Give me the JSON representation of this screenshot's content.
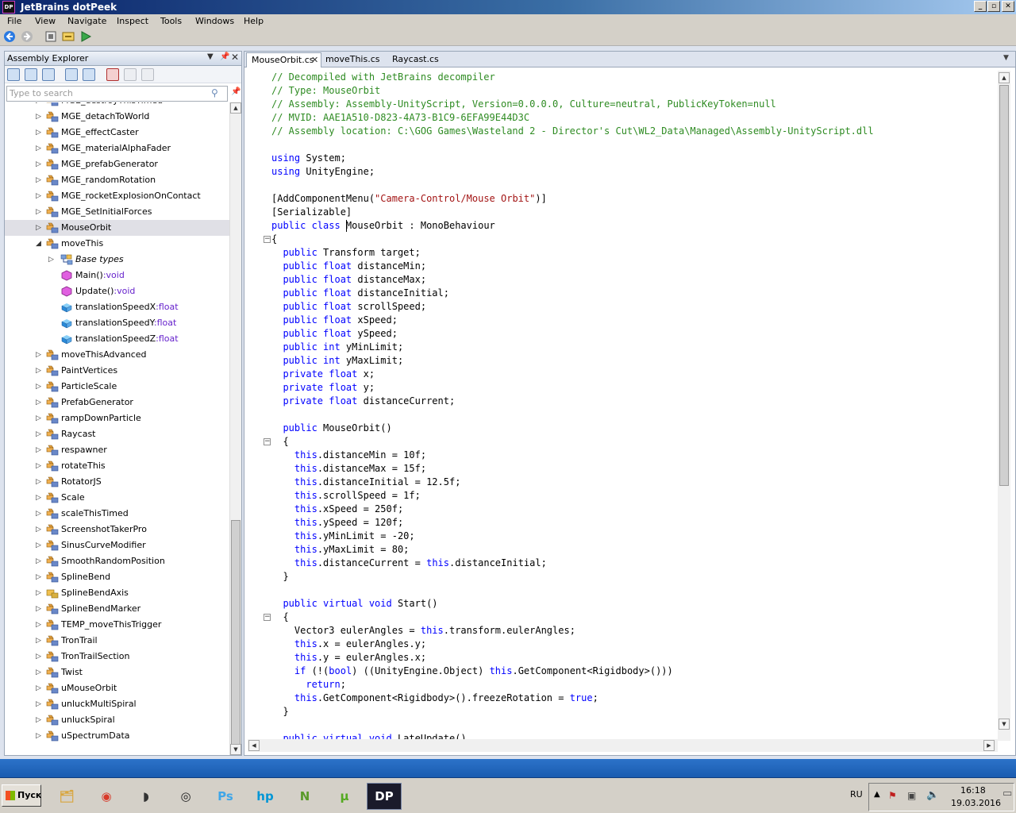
{
  "window": {
    "title": "JetBrains dotPeek",
    "icon": "DP",
    "minimize": "_",
    "maximize": "▫",
    "close": "✕"
  },
  "menu": [
    "File",
    "View",
    "Navigate",
    "Inspect",
    "Tools",
    "Windows",
    "Help"
  ],
  "explorer": {
    "title": "Assembly Explorer",
    "search_placeholder": "Type to search",
    "items": [
      {
        "label": "MGE_destroyThisTimed",
        "icon": "class-icon",
        "level": 0,
        "arrow": "▷"
      },
      {
        "label": "MGE_detachToWorld",
        "icon": "class-icon",
        "level": 0,
        "arrow": "▷"
      },
      {
        "label": "MGE_effectCaster",
        "icon": "class-icon",
        "level": 0,
        "arrow": "▷"
      },
      {
        "label": "MGE_materialAlphaFader",
        "icon": "class-icon",
        "level": 0,
        "arrow": "▷"
      },
      {
        "label": "MGE_prefabGenerator",
        "icon": "class-icon",
        "level": 0,
        "arrow": "▷"
      },
      {
        "label": "MGE_randomRotation",
        "icon": "class-icon",
        "level": 0,
        "arrow": "▷"
      },
      {
        "label": "MGE_rocketExplosionOnContact",
        "icon": "class-icon",
        "level": 0,
        "arrow": "▷"
      },
      {
        "label": "MGE_SetInitialForces",
        "icon": "class-icon",
        "level": 0,
        "arrow": "▷"
      },
      {
        "label": "MouseOrbit",
        "icon": "class-icon",
        "level": 0,
        "arrow": "▷",
        "selected": true
      },
      {
        "label": "moveThis",
        "icon": "class-icon",
        "level": 0,
        "arrow": "◢"
      },
      {
        "label": "Base types",
        "icon": "base-types-icon",
        "level": 1,
        "arrow": "▷",
        "italic": true
      },
      {
        "label": "Main()",
        "type": ":void",
        "icon": "method-icon",
        "level": 1,
        "arrow": ""
      },
      {
        "label": "Update()",
        "type": ":void",
        "icon": "method-icon",
        "level": 1,
        "arrow": ""
      },
      {
        "label": "translationSpeedX",
        "type": ":float",
        "icon": "field-icon",
        "level": 1,
        "arrow": ""
      },
      {
        "label": "translationSpeedY",
        "type": ":float",
        "icon": "field-icon",
        "level": 1,
        "arrow": ""
      },
      {
        "label": "translationSpeedZ",
        "type": ":float",
        "icon": "field-icon",
        "level": 1,
        "arrow": ""
      },
      {
        "label": "moveThisAdvanced",
        "icon": "class-icon",
        "level": 0,
        "arrow": "▷"
      },
      {
        "label": "PaintVertices",
        "icon": "class-icon",
        "level": 0,
        "arrow": "▷"
      },
      {
        "label": "ParticleScale",
        "icon": "class-icon",
        "level": 0,
        "arrow": "▷"
      },
      {
        "label": "PrefabGenerator",
        "icon": "class-icon",
        "level": 0,
        "arrow": "▷"
      },
      {
        "label": "rampDownParticle",
        "icon": "class-icon",
        "level": 0,
        "arrow": "▷"
      },
      {
        "label": "Raycast",
        "icon": "class-icon",
        "level": 0,
        "arrow": "▷"
      },
      {
        "label": "respawner",
        "icon": "class-icon",
        "level": 0,
        "arrow": "▷"
      },
      {
        "label": "rotateThis",
        "icon": "class-icon",
        "level": 0,
        "arrow": "▷"
      },
      {
        "label": "RotatorJS",
        "icon": "class-icon",
        "level": 0,
        "arrow": "▷"
      },
      {
        "label": "Scale",
        "icon": "class-icon",
        "level": 0,
        "arrow": "▷"
      },
      {
        "label": "scaleThisTimed",
        "icon": "class-icon",
        "level": 0,
        "arrow": "▷"
      },
      {
        "label": "ScreenshotTakerPro",
        "icon": "class-icon",
        "level": 0,
        "arrow": "▷"
      },
      {
        "label": "SinusCurveModifier",
        "icon": "class-icon",
        "level": 0,
        "arrow": "▷"
      },
      {
        "label": "SmoothRandomPosition",
        "icon": "class-icon",
        "level": 0,
        "arrow": "▷"
      },
      {
        "label": "SplineBend",
        "icon": "class-icon",
        "level": 0,
        "arrow": "▷"
      },
      {
        "label": "SplineBendAxis",
        "icon": "enum-icon",
        "level": 0,
        "arrow": "▷"
      },
      {
        "label": "SplineBendMarker",
        "icon": "class-icon",
        "level": 0,
        "arrow": "▷"
      },
      {
        "label": "TEMP_moveThisTrigger",
        "icon": "class-icon",
        "level": 0,
        "arrow": "▷"
      },
      {
        "label": "TronTrail",
        "icon": "class-icon",
        "level": 0,
        "arrow": "▷"
      },
      {
        "label": "TronTrailSection",
        "icon": "class-icon",
        "level": 0,
        "arrow": "▷"
      },
      {
        "label": "Twist",
        "icon": "class-icon",
        "level": 0,
        "arrow": "▷"
      },
      {
        "label": "uMouseOrbit",
        "icon": "class-icon",
        "level": 0,
        "arrow": "▷"
      },
      {
        "label": "unluckMultiSpiral",
        "icon": "class-icon",
        "level": 0,
        "arrow": "▷"
      },
      {
        "label": "unluckSpiral",
        "icon": "class-icon",
        "level": 0,
        "arrow": "▷"
      },
      {
        "label": "uSpectrumData",
        "icon": "class-icon",
        "level": 0,
        "arrow": "▷"
      }
    ]
  },
  "tabs": [
    {
      "label": "MouseOrbit.cs",
      "active": true
    },
    {
      "label": "moveThis.cs",
      "active": false
    },
    {
      "label": "Raycast.cs",
      "active": false
    }
  ],
  "code": [
    [
      [
        "cm",
        "// Decompiled with JetBrains decompiler"
      ]
    ],
    [
      [
        "cm",
        "// Type: MouseOrbit"
      ]
    ],
    [
      [
        "cm",
        "// Assembly: Assembly-UnityScript, Version=0.0.0.0, Culture=neutral, PublicKeyToken=null"
      ]
    ],
    [
      [
        "cm",
        "// MVID: AAE1A510-D823-4A73-B1C9-6EFA99E44D3C"
      ]
    ],
    [
      [
        "cm",
        "// Assembly location: C:\\GOG Games\\Wasteland 2 - Director's Cut\\WL2_Data\\Managed\\Assembly-UnityScript.dll"
      ]
    ],
    [],
    [
      [
        "kw",
        "using"
      ],
      [
        "",
        " System;"
      ]
    ],
    [
      [
        "kw",
        "using"
      ],
      [
        "",
        " UnityEngine;"
      ]
    ],
    [],
    [
      [
        "",
        "[AddComponentMenu("
      ],
      [
        "st",
        "\"Camera-Control/Mouse Orbit\""
      ],
      [
        "",
        ")]"
      ]
    ],
    [
      [
        "",
        "[Serializable]"
      ]
    ],
    [
      [
        "kw",
        "public class"
      ],
      [
        "",
        " MouseOrbit : MonoBehaviour"
      ]
    ],
    [
      [
        "",
        "{"
      ]
    ],
    [
      [
        "",
        "  "
      ],
      [
        "kw",
        "public"
      ],
      [
        "",
        " Transform target;"
      ]
    ],
    [
      [
        "",
        "  "
      ],
      [
        "kw",
        "public float"
      ],
      [
        "",
        " distanceMin;"
      ]
    ],
    [
      [
        "",
        "  "
      ],
      [
        "kw",
        "public float"
      ],
      [
        "",
        " distanceMax;"
      ]
    ],
    [
      [
        "",
        "  "
      ],
      [
        "kw",
        "public float"
      ],
      [
        "",
        " distanceInitial;"
      ]
    ],
    [
      [
        "",
        "  "
      ],
      [
        "kw",
        "public float"
      ],
      [
        "",
        " scrollSpeed;"
      ]
    ],
    [
      [
        "",
        "  "
      ],
      [
        "kw",
        "public float"
      ],
      [
        "",
        " xSpeed;"
      ]
    ],
    [
      [
        "",
        "  "
      ],
      [
        "kw",
        "public float"
      ],
      [
        "",
        " ySpeed;"
      ]
    ],
    [
      [
        "",
        "  "
      ],
      [
        "kw",
        "public int"
      ],
      [
        "",
        " yMinLimit;"
      ]
    ],
    [
      [
        "",
        "  "
      ],
      [
        "kw",
        "public int"
      ],
      [
        "",
        " yMaxLimit;"
      ]
    ],
    [
      [
        "",
        "  "
      ],
      [
        "kw",
        "private float"
      ],
      [
        "",
        " x;"
      ]
    ],
    [
      [
        "",
        "  "
      ],
      [
        "kw",
        "private float"
      ],
      [
        "",
        " y;"
      ]
    ],
    [
      [
        "",
        "  "
      ],
      [
        "kw",
        "private float"
      ],
      [
        "",
        " distanceCurrent;"
      ]
    ],
    [],
    [
      [
        "",
        "  "
      ],
      [
        "kw",
        "public"
      ],
      [
        "",
        " MouseOrbit()"
      ]
    ],
    [
      [
        "",
        "  {"
      ]
    ],
    [
      [
        "",
        "    "
      ],
      [
        "kw",
        "this"
      ],
      [
        "",
        ".distanceMin = 10f;"
      ]
    ],
    [
      [
        "",
        "    "
      ],
      [
        "kw",
        "this"
      ],
      [
        "",
        ".distanceMax = 15f;"
      ]
    ],
    [
      [
        "",
        "    "
      ],
      [
        "kw",
        "this"
      ],
      [
        "",
        ".distanceInitial = 12.5f;"
      ]
    ],
    [
      [
        "",
        "    "
      ],
      [
        "kw",
        "this"
      ],
      [
        "",
        ".scrollSpeed = 1f;"
      ]
    ],
    [
      [
        "",
        "    "
      ],
      [
        "kw",
        "this"
      ],
      [
        "",
        ".xSpeed = 250f;"
      ]
    ],
    [
      [
        "",
        "    "
      ],
      [
        "kw",
        "this"
      ],
      [
        "",
        ".ySpeed = 120f;"
      ]
    ],
    [
      [
        "",
        "    "
      ],
      [
        "kw",
        "this"
      ],
      [
        "",
        ".yMinLimit = -20;"
      ]
    ],
    [
      [
        "",
        "    "
      ],
      [
        "kw",
        "this"
      ],
      [
        "",
        ".yMaxLimit = 80;"
      ]
    ],
    [
      [
        "",
        "    "
      ],
      [
        "kw",
        "this"
      ],
      [
        "",
        ".distanceCurrent = "
      ],
      [
        "kw",
        "this"
      ],
      [
        "",
        ".distanceInitial;"
      ]
    ],
    [
      [
        "",
        "  }"
      ]
    ],
    [],
    [
      [
        "",
        "  "
      ],
      [
        "kw",
        "public virtual void"
      ],
      [
        "",
        " Start()"
      ]
    ],
    [
      [
        "",
        "  {"
      ]
    ],
    [
      [
        "",
        "    Vector3 eulerAngles = "
      ],
      [
        "kw",
        "this"
      ],
      [
        "",
        ".transform.eulerAngles;"
      ]
    ],
    [
      [
        "",
        "    "
      ],
      [
        "kw",
        "this"
      ],
      [
        "",
        ".x = eulerAngles.y;"
      ]
    ],
    [
      [
        "",
        "    "
      ],
      [
        "kw",
        "this"
      ],
      [
        "",
        ".y = eulerAngles.x;"
      ]
    ],
    [
      [
        "",
        "    "
      ],
      [
        "kw",
        "if"
      ],
      [
        "",
        " (!("
      ],
      [
        "kw",
        "bool"
      ],
      [
        "",
        ") ((UnityEngine.Object) "
      ],
      [
        "kw",
        "this"
      ],
      [
        "",
        ".GetComponent<Rigidbody>()))"
      ]
    ],
    [
      [
        "",
        "      "
      ],
      [
        "kw",
        "return"
      ],
      [
        "",
        ";"
      ]
    ],
    [
      [
        "",
        "    "
      ],
      [
        "kw",
        "this"
      ],
      [
        "",
        ".GetComponent<Rigidbody>().freezeRotation = "
      ],
      [
        "kw",
        "true"
      ],
      [
        "",
        ";"
      ]
    ],
    [
      [
        "",
        "  }"
      ]
    ],
    [],
    [
      [
        "",
        "  "
      ],
      [
        "kw",
        "public virtual void"
      ],
      [
        "",
        " LateUpdate()"
      ]
    ]
  ],
  "taskbar": {
    "start": "Пуск",
    "apps": [
      {
        "name": "explorer",
        "glyph": "🗂",
        "color": "#d8a640"
      },
      {
        "name": "chrome",
        "glyph": "◉",
        "color": "#d83a2a"
      },
      {
        "name": "unknown-app",
        "glyph": "◗",
        "color": "#333333"
      },
      {
        "name": "unity",
        "glyph": "◎",
        "color": "#222222"
      },
      {
        "name": "photoshop",
        "glyph": "Ps",
        "color": "#3fa6e8"
      },
      {
        "name": "hp",
        "glyph": "hp",
        "color": "#0096d6"
      },
      {
        "name": "notepad-plus",
        "glyph": "N",
        "color": "#5a9a2a"
      },
      {
        "name": "utorrent",
        "glyph": "μ",
        "color": "#55aa22"
      },
      {
        "name": "dotpeek",
        "glyph": "DP",
        "color": "#ffffff",
        "active": true
      }
    ],
    "lang": "RU",
    "time": "16:18",
    "date": "19.03.2016"
  }
}
